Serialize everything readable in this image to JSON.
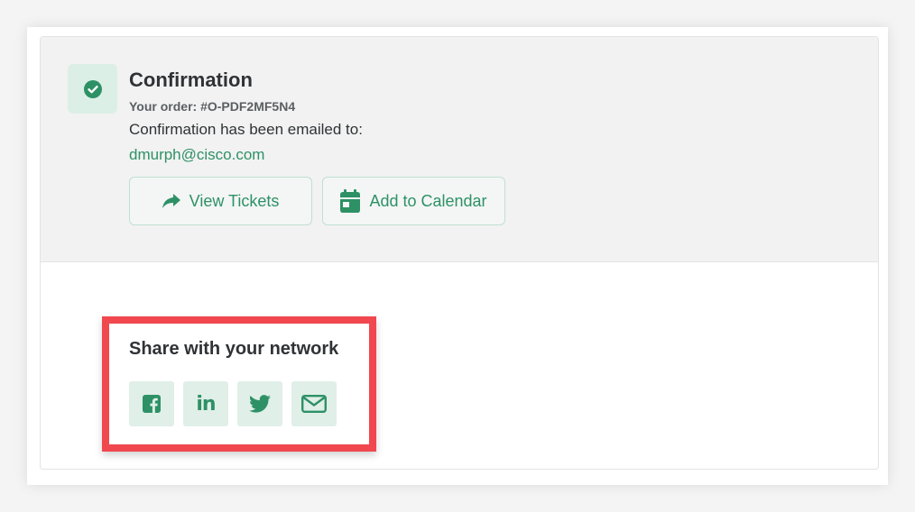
{
  "confirmation": {
    "title": "Confirmation",
    "order_label": "Your order: #O-PDF2MF5N4",
    "emailed_text": "Confirmation has been emailed to:",
    "email": "dmurph@cisco.com",
    "status_icon": "check-circle-icon"
  },
  "actions": {
    "view_tickets_label": "View Tickets",
    "view_tickets_icon": "share-arrow-icon",
    "add_calendar_label": "Add to Calendar",
    "add_calendar_icon": "calendar-icon"
  },
  "share": {
    "title": "Share with your network",
    "networks": [
      {
        "icon": "facebook-icon"
      },
      {
        "icon": "linkedin-icon",
        "glyph": "in"
      },
      {
        "icon": "twitter-icon"
      },
      {
        "icon": "envelope-icon"
      }
    ]
  },
  "colors": {
    "accent": "#2e9166",
    "accent_bg": "#e0efe8",
    "highlight": "#f0484e",
    "panel_bg": "#f2f2f2"
  }
}
